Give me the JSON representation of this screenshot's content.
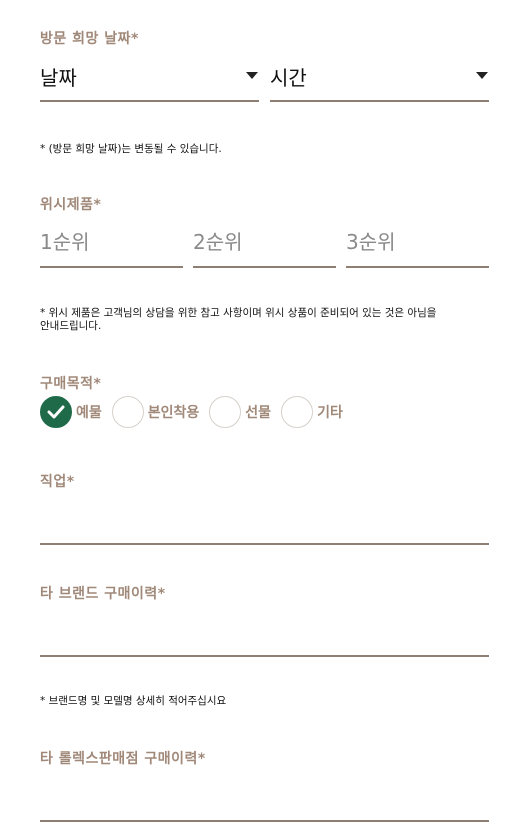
{
  "visit": {
    "label": "방문 희망 날짜*",
    "date_value": "날짜",
    "time_value": "시간",
    "note": "* (방문 희망 날짜)는 변동될 수 있습니다."
  },
  "wish": {
    "label": "위시제품*",
    "placeholders": [
      "1순위",
      "2순위",
      "3순위"
    ],
    "note_line1": "* 위시 제품은 고객님의 상담을 위한 참고 사항이며 위시 상품이 준비되어 있는 것은 아님을",
    "note_line2": "안내드립니다."
  },
  "purpose": {
    "label": "구매목적*",
    "options": [
      "예물",
      "본인착용",
      "선물",
      "기타"
    ],
    "selected": "예물"
  },
  "job": {
    "label": "직업*",
    "value": ""
  },
  "other_brand": {
    "label": "타 브랜드 구매이력*",
    "value": "",
    "note": "* 브랜드명 및 모델명 상세히 적어주십시요"
  },
  "rolex_store": {
    "label": "타 롤렉스판매점 구매이력*",
    "value": ""
  },
  "colors": {
    "accent": "#1f6a49",
    "label": "#a1897a",
    "line": "#8f7f72"
  }
}
